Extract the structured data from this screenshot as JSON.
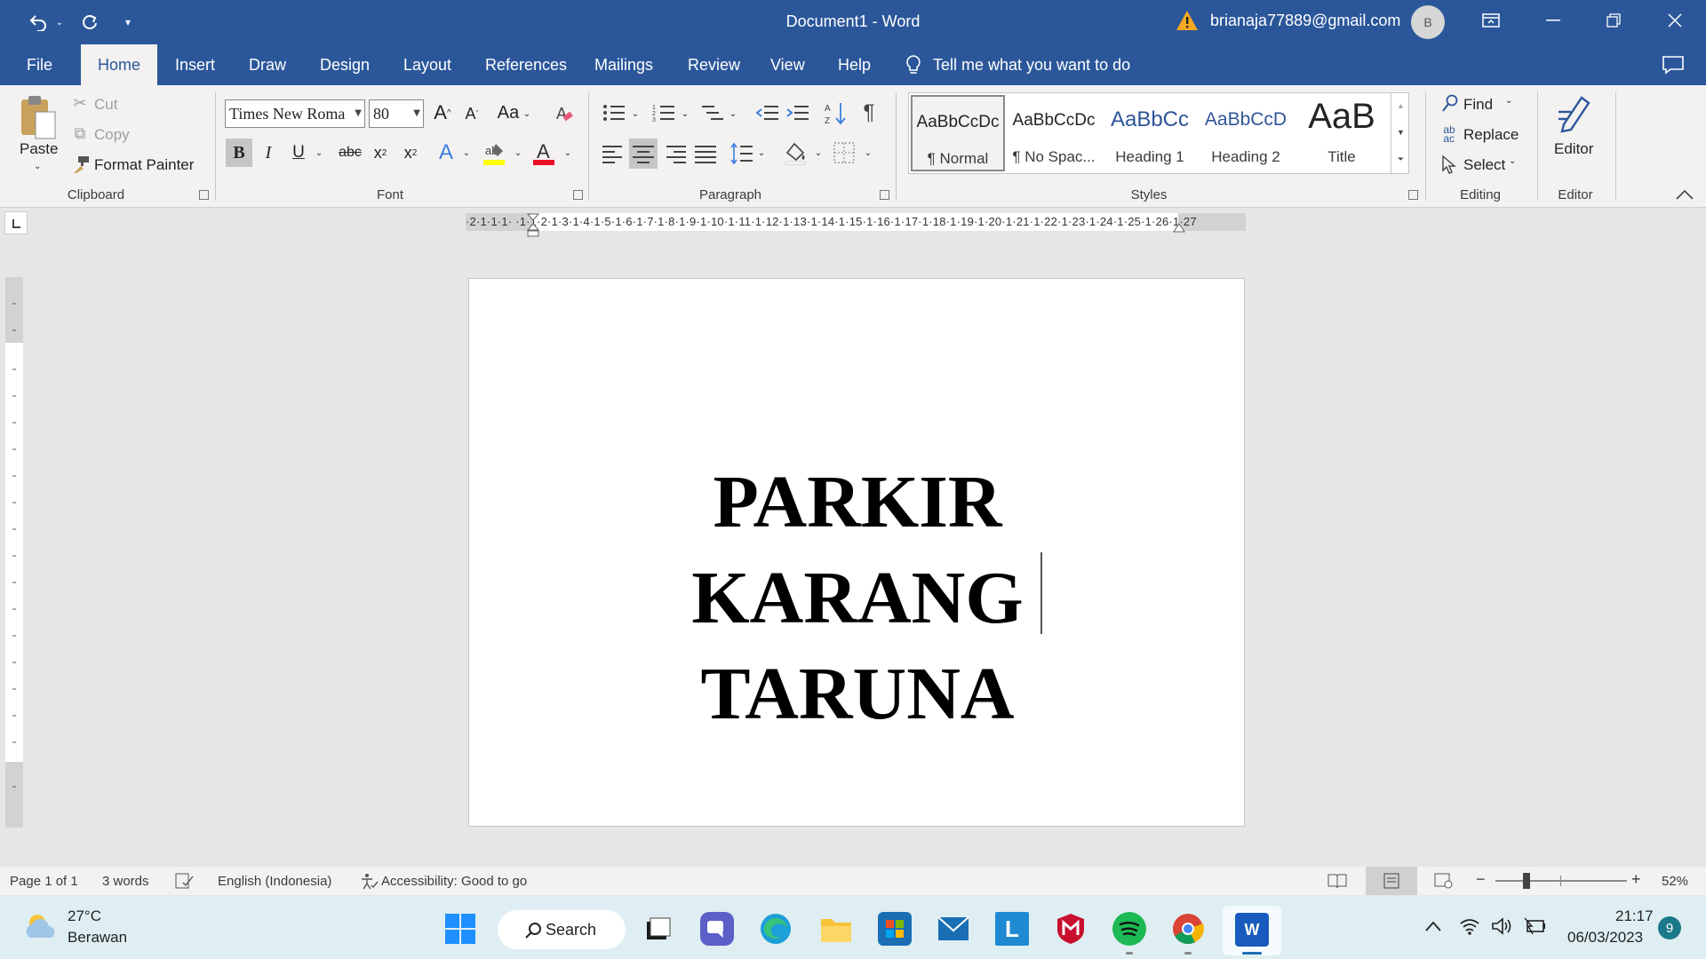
{
  "titlebar": {
    "doc_title": "Document1  -  Word",
    "account_email": "brianaja77889@gmail.com",
    "avatar_initial": "B"
  },
  "tabs": [
    {
      "label": "File"
    },
    {
      "label": "Home"
    },
    {
      "label": "Insert"
    },
    {
      "label": "Draw"
    },
    {
      "label": "Design"
    },
    {
      "label": "Layout"
    },
    {
      "label": "References"
    },
    {
      "label": "Mailings"
    },
    {
      "label": "Review"
    },
    {
      "label": "View"
    },
    {
      "label": "Help"
    }
  ],
  "tell_me": "Tell me what you want to do",
  "clipboard": {
    "paste": "Paste",
    "cut": "Cut",
    "copy": "Copy",
    "format_painter": "Format Painter",
    "group_label": "Clipboard"
  },
  "font": {
    "font_name": "Times New Roma",
    "font_size": "80",
    "case_label": "Aa",
    "group_label": "Font",
    "font_color": "#e81123",
    "highlight_color": "#ffff00"
  },
  "paragraph": {
    "group_label": "Paragraph"
  },
  "styles": {
    "group_label": "Styles",
    "items": [
      {
        "preview": "AaBbCcDc",
        "name": "¶ Normal"
      },
      {
        "preview": "AaBbCcDc",
        "name": "¶ No Spac..."
      },
      {
        "preview": "AaBbCc",
        "name": "Heading 1"
      },
      {
        "preview": "AaBbCcD",
        "name": "Heading 2"
      },
      {
        "preview": "AaB",
        "name": "Title"
      }
    ]
  },
  "editing": {
    "find": "Find",
    "replace": "Replace",
    "select": "Select",
    "group_label": "Editing"
  },
  "editor": {
    "label": "Editor",
    "group_label": "Editor"
  },
  "ruler": {
    "h_numbers": "·2·1·1·1·   ·1·1·2·1·3·1·4·1·5·1·6·1·7·1·8·1·9·1·10·1·11·1·12·1·13·1·14·1·15·1·16·1·17·1·18·1·19·1·20·1·21·1·22·1·23·1·24·1·25·1·26·1·27"
  },
  "document": {
    "lines": [
      "PARKIR",
      "KARANG",
      "TARUNA"
    ]
  },
  "status": {
    "page": "Page 1 of 1",
    "words": "3 words",
    "language": "English (Indonesia)",
    "accessibility": "Accessibility: Good to go",
    "zoom": "52%",
    "zoom_level": 0.52
  },
  "taskbar": {
    "weather_temp": "27°C",
    "weather_desc": "Berawan",
    "search": "Search",
    "time": "21:17",
    "date": "06/03/2023",
    "notif_count": "9"
  }
}
